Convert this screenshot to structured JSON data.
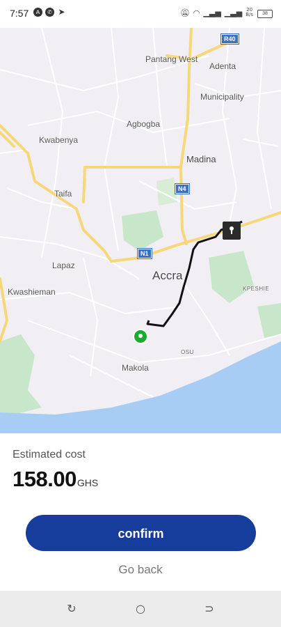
{
  "status_bar": {
    "time": "7:57",
    "left_icons": [
      "app-a-icon",
      "whatsapp-icon",
      "telegram-icon"
    ],
    "right_icons": [
      "mute-icon",
      "wifi-icon",
      "signal-icon",
      "signal-icon"
    ],
    "speed": "20",
    "speed_unit": "B/s",
    "battery": "38"
  },
  "map": {
    "labels": {
      "pantang_west": "Pantang West",
      "adenta_1": "Adenta",
      "adenta_2": "Municipality",
      "agbogba": "Agbogba",
      "kwabenya": "Kwabenya",
      "madina": "Madina",
      "taifa": "Taifa",
      "lapaz": "Lapaz",
      "accra": "Accra",
      "kpeshie": "KPESHIE",
      "kwashieman": "Kwashieman",
      "osu": "OSU",
      "makola": "Makola"
    },
    "shields": {
      "r40": "R40",
      "n4": "N4",
      "n1": "N1"
    },
    "colors": {
      "land": "#f1eff3",
      "water": "#a8cdf5",
      "park": "#c8e6c9",
      "highway": "#f6d77a",
      "route": "#111111",
      "origin_pin": "#1aab2f",
      "destination_pin": "#2b2b2b"
    }
  },
  "fare": {
    "label": "Estimated cost",
    "value": "158.00",
    "currency": "GHS"
  },
  "actions": {
    "confirm": "confirm",
    "go_back": "Go back"
  },
  "nav_bar": {
    "icons": [
      "recent-apps-icon",
      "home-icon",
      "back-icon"
    ]
  },
  "theme": {
    "primary": "#163c9c"
  }
}
